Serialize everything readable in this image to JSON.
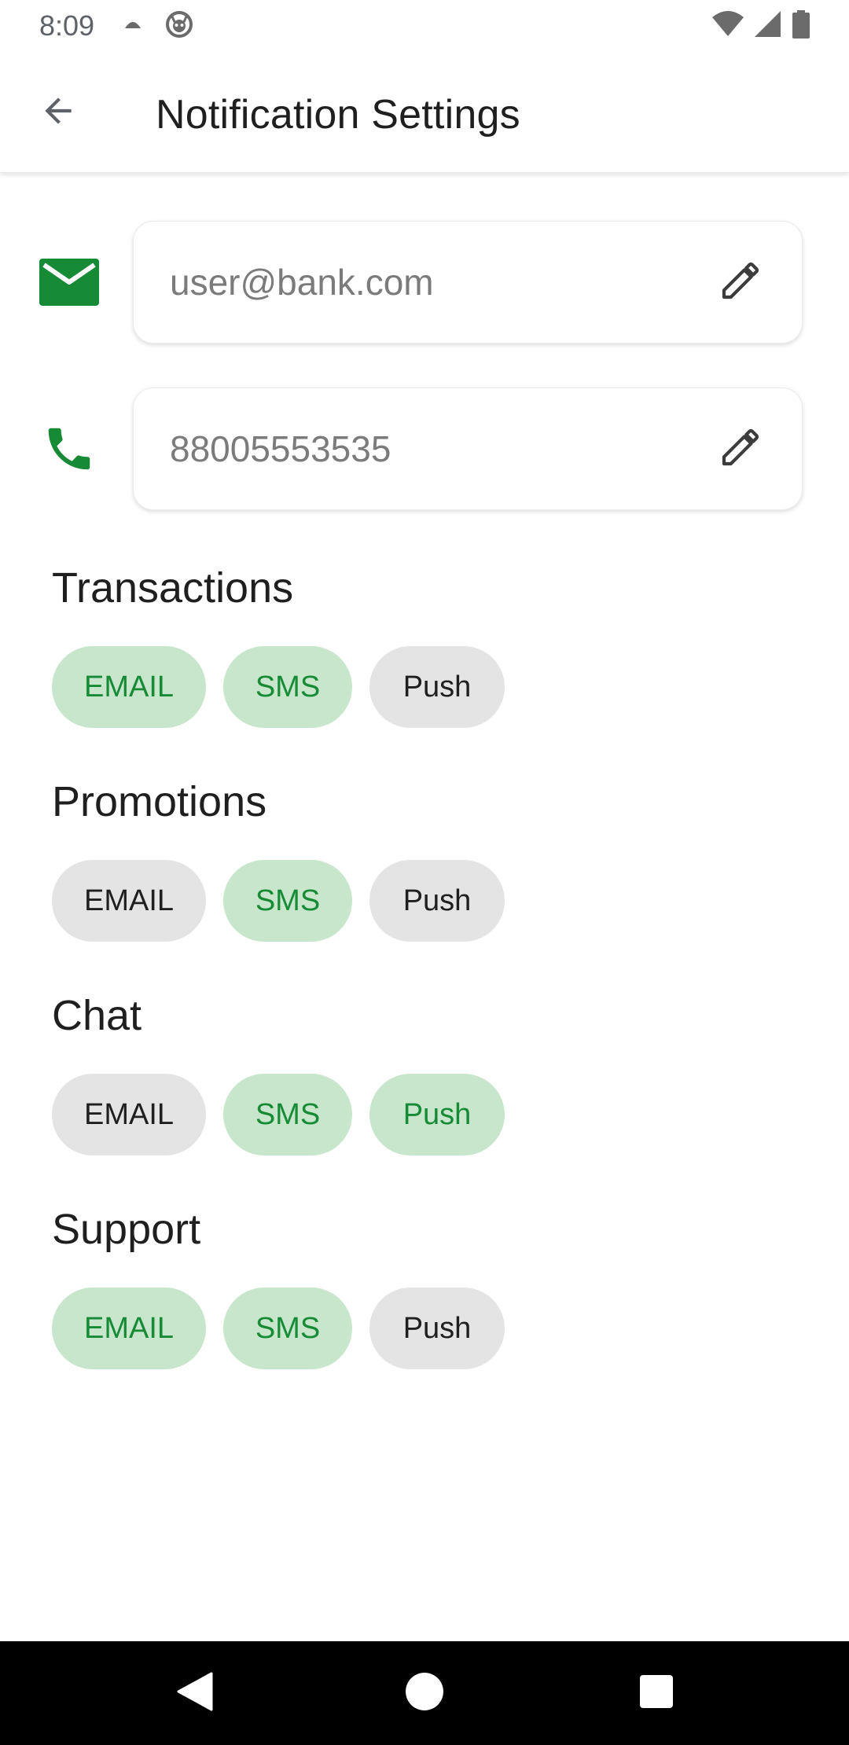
{
  "status_bar": {
    "time": "8:09",
    "icons": [
      "umbrella-notification-icon",
      "robot-notification-icon",
      "wifi-icon",
      "cellular-signal-icon",
      "battery-icon"
    ]
  },
  "app_bar": {
    "title": "Notification Settings",
    "back_icon": "arrow-back-icon"
  },
  "contacts": {
    "email": {
      "value": "user@bank.com",
      "icon": "mail-icon",
      "edit_icon": "pencil-icon"
    },
    "phone": {
      "value": "88005553535",
      "icon": "phone-icon",
      "edit_icon": "pencil-icon"
    }
  },
  "categories": [
    {
      "title": "Transactions",
      "channels": [
        {
          "label": "EMAIL",
          "selected": true
        },
        {
          "label": "SMS",
          "selected": true
        },
        {
          "label": "Push",
          "selected": false
        }
      ]
    },
    {
      "title": "Promotions",
      "channels": [
        {
          "label": "EMAIL",
          "selected": false
        },
        {
          "label": "SMS",
          "selected": true
        },
        {
          "label": "Push",
          "selected": false
        }
      ]
    },
    {
      "title": "Chat",
      "channels": [
        {
          "label": "EMAIL",
          "selected": false
        },
        {
          "label": "SMS",
          "selected": true
        },
        {
          "label": "Push",
          "selected": true
        }
      ]
    },
    {
      "title": "Support",
      "channels": [
        {
          "label": "EMAIL",
          "selected": true
        },
        {
          "label": "SMS",
          "selected": true
        },
        {
          "label": "Push",
          "selected": false
        }
      ]
    }
  ],
  "colors": {
    "accent": "#178a36",
    "chip_selected_bg": "#c8e6cc",
    "chip_unselected_bg": "#e4e4e4",
    "nav_bar_bg": "#000000"
  },
  "nav_bar": {
    "buttons": [
      "back-triangle-icon",
      "home-circle-icon",
      "recents-square-icon"
    ]
  }
}
